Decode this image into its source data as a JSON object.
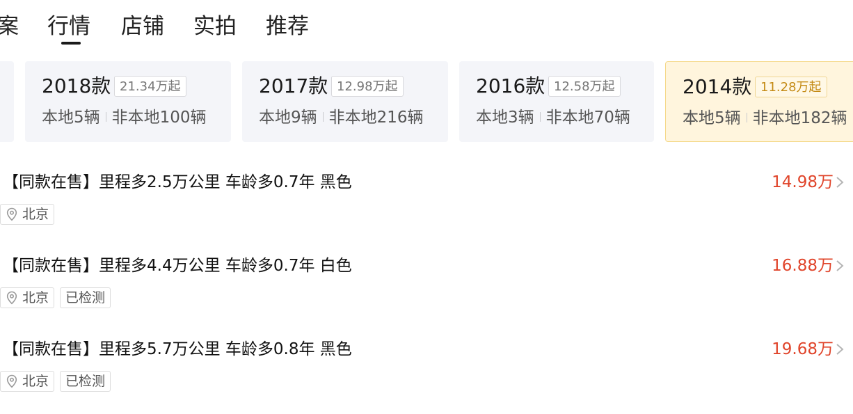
{
  "tabs": [
    {
      "label": "案"
    },
    {
      "label": "行情"
    },
    {
      "label": "店铺"
    },
    {
      "label": "实拍"
    },
    {
      "label": "推荐"
    }
  ],
  "active_tab": "行情",
  "year_cards": [
    {
      "year": "2018款",
      "price": "21.34万起",
      "local": "本地5辆",
      "remote": "非本地100辆",
      "selected": false
    },
    {
      "year": "2017款",
      "price": "12.98万起",
      "local": "本地9辆",
      "remote": "非本地216辆",
      "selected": false
    },
    {
      "year": "2016款",
      "price": "12.58万起",
      "local": "本地3辆",
      "remote": "非本地70辆",
      "selected": false
    },
    {
      "year": "2014款",
      "price": "11.28万起",
      "local": "本地5辆",
      "remote": "非本地182辆",
      "selected": true
    }
  ],
  "listings": [
    {
      "title": "【同款在售】里程多2.5万公里 车龄多0.7年 黑色",
      "price": "14.98万",
      "location": "北京",
      "tags": []
    },
    {
      "title": "【同款在售】里程多4.4万公里 车龄多0.7年 白色",
      "price": "16.88万",
      "location": "北京",
      "tags": [
        "已检测"
      ]
    },
    {
      "title": "【同款在售】里程多5.7万公里 车龄多0.8年 黑色",
      "price": "19.68万",
      "location": "北京",
      "tags": [
        "已检测"
      ]
    }
  ],
  "colors": {
    "price": "#e0442a",
    "selected_card_bg": "#fff5dd",
    "card_bg": "#f4f5f9"
  },
  "icons": {
    "location": "map-pin-icon",
    "arrow": "chevron-right-icon"
  }
}
